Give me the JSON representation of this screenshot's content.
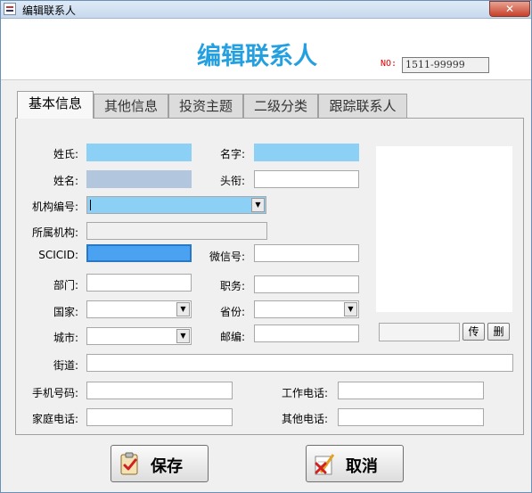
{
  "window": {
    "title": "编辑联系人",
    "close_glyph": "✕"
  },
  "header": {
    "title": "编辑联系人",
    "no_label": "NO:",
    "no_value": "1511-99999"
  },
  "tabs": [
    "基本信息",
    "其他信息",
    "投资主题",
    "二级分类",
    "跟踪联系人"
  ],
  "form": {
    "surname": "姓氏:",
    "given_name": "名字:",
    "full_name": "姓名:",
    "title": "头衔:",
    "org_code": "机构编号:",
    "org_name": "所属机构:",
    "scicid": "SCICID:",
    "wechat": "微信号:",
    "department": "部门:",
    "position": "职务:",
    "country": "国家:",
    "province": "省份:",
    "city": "城市:",
    "postcode": "邮编:",
    "street": "街道:",
    "mobile": "手机号码:",
    "work_phone": "工作电话:",
    "home_phone": "家庭电话:",
    "other_phone": "其他电话:"
  },
  "photo": {
    "upload_label": "传",
    "delete_label": "删"
  },
  "buttons": {
    "save": "保存",
    "cancel": "取消"
  },
  "icons": {
    "dropdown": "▼"
  },
  "colors": {
    "title_blue": "#24a0e0",
    "no_red": "#e00000",
    "field_blue": "#8cd0f6",
    "field_strong": "#4aa2f0"
  }
}
